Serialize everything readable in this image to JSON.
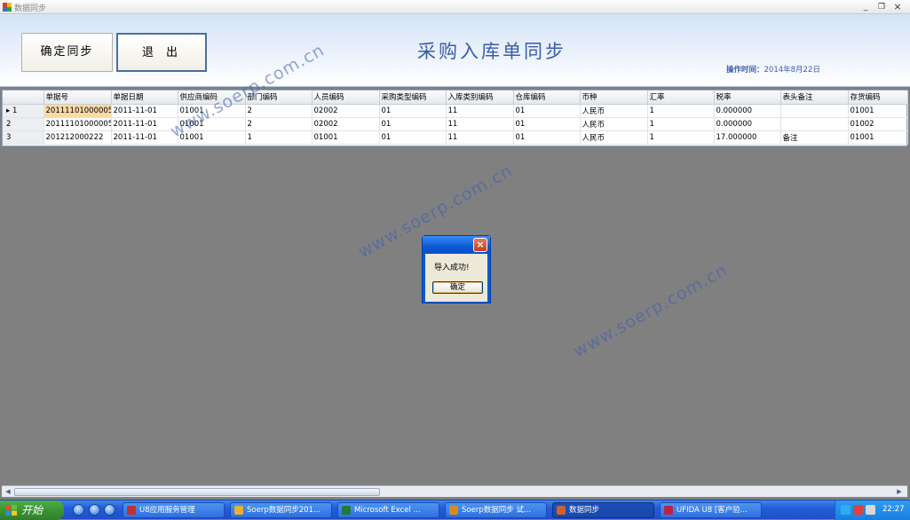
{
  "window": {
    "title": "数据同步",
    "minimize": "_",
    "restore": "❐",
    "close": "×"
  },
  "header": {
    "confirm_label": "确定同步",
    "exit_label": "退出",
    "page_title": "采购入库单同步",
    "op_time_label": "操作时间：",
    "op_time_value": "2014年8月22日"
  },
  "grid": {
    "columns": [
      "单据号",
      "单据日期",
      "供应商编码",
      "部门编码",
      "人员编码",
      "采购类型编码",
      "入库类别编码",
      "仓库编码",
      "币种",
      "汇率",
      "税率",
      "表头备注",
      "存货编码"
    ],
    "rows": [
      {
        "num": "1",
        "cells": [
          "20111101000005",
          "2011-11-01",
          "01001",
          "2",
          "02002",
          "01",
          "11",
          "01",
          "人民币",
          "1",
          "0.000000",
          "",
          "01001"
        ]
      },
      {
        "num": "2",
        "cells": [
          "20111101000005",
          "2011-11-01",
          "01001",
          "2",
          "02002",
          "01",
          "11",
          "01",
          "人民币",
          "1",
          "0.000000",
          "",
          "01002"
        ]
      },
      {
        "num": "3",
        "cells": [
          "201212000222",
          "2011-11-01",
          "01001",
          "1",
          "01001",
          "01",
          "11",
          "01",
          "人民币",
          "1",
          "17.000000",
          "备注",
          "01001"
        ]
      }
    ]
  },
  "dialog": {
    "message": "导入成功!",
    "ok_label": "确定",
    "close": "×"
  },
  "watermark": "www.soerp.com.cn",
  "taskbar": {
    "start_label": "开始",
    "items": [
      {
        "label": "U8应用服务管理",
        "color": "#c03030"
      },
      {
        "label": "Soerp数据同步201...",
        "color": "#e8b030"
      },
      {
        "label": "Microsoft Excel ...",
        "color": "#1f7a3a"
      },
      {
        "label": "Soerp数据同步 试...",
        "color": "#d88a20"
      },
      {
        "label": "数据同步",
        "color": "#d06030"
      },
      {
        "label": "UFIDA U8 [客户验...",
        "color": "#c02040"
      }
    ],
    "clock": "22:27"
  }
}
